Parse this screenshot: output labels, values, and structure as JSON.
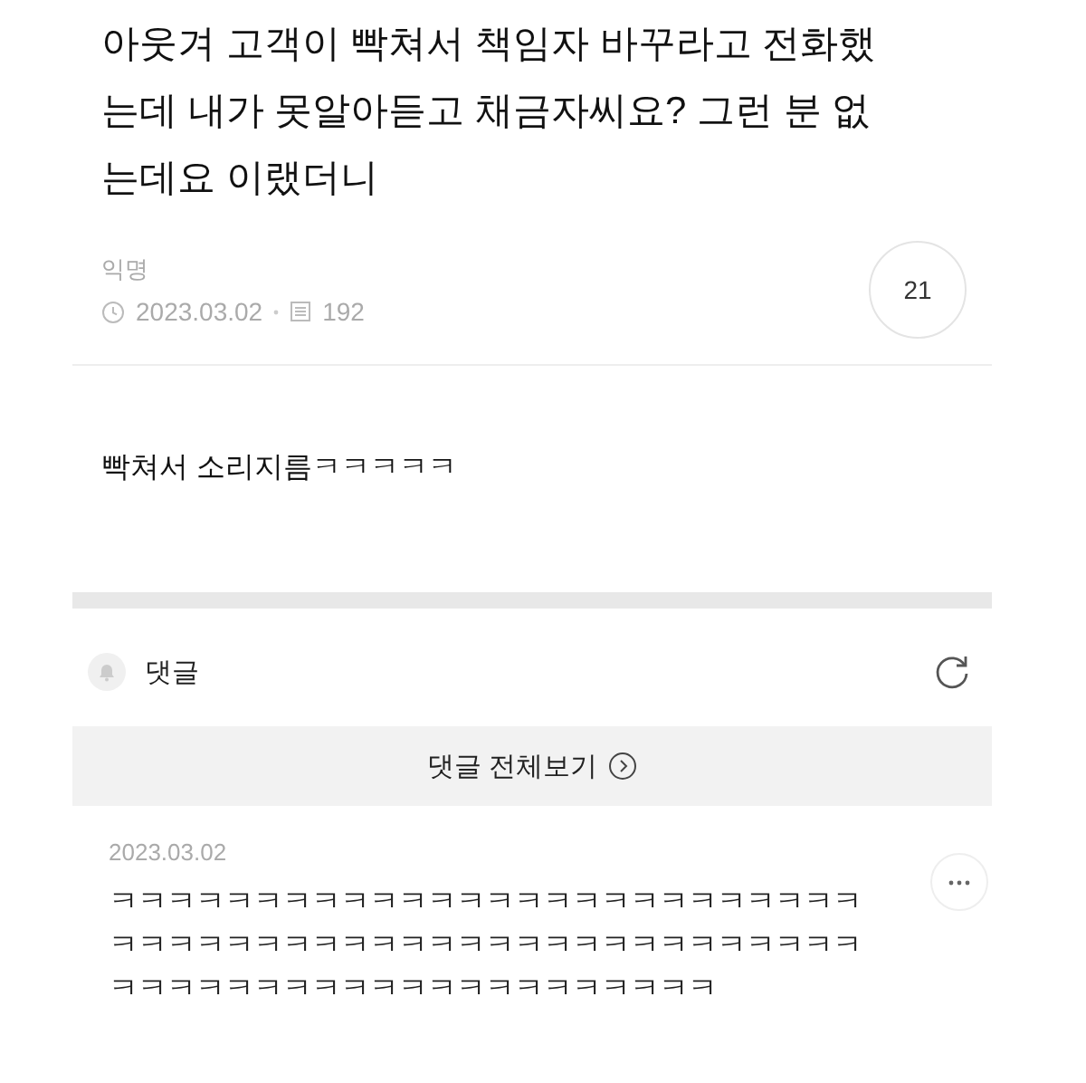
{
  "post": {
    "title": "아웃겨 고객이 빡쳐서 책임자 바꾸라고 전화했는데 내가 못알아듣고 채금자씨요? 그런 분 없는데요 이랬더니",
    "author": "익명",
    "date": "2023.03.02",
    "views": "192",
    "comment_count": "21",
    "body": "빡쳐서 소리지름ㅋㅋㅋㅋㅋ"
  },
  "comments_header": {
    "label": "댓글"
  },
  "view_all_button": {
    "label": "댓글 전체보기"
  },
  "comments": [
    {
      "date": "2023.03.02",
      "text": "ㅋㅋㅋㅋㅋㅋㅋㅋㅋㅋㅋㅋㅋㅋㅋㅋㅋㅋㅋㅋㅋㅋㅋㅋㅋㅋㅋㅋㅋㅋㅋㅋㅋㅋㅋㅋㅋㅋㅋㅋㅋㅋㅋㅋㅋㅋㅋㅋㅋㅋㅋㅋㅋㅋㅋㅋㅋㅋㅋㅋㅋㅋㅋㅋㅋㅋㅋㅋㅋㅋㅋㅋㅋ"
    }
  ]
}
